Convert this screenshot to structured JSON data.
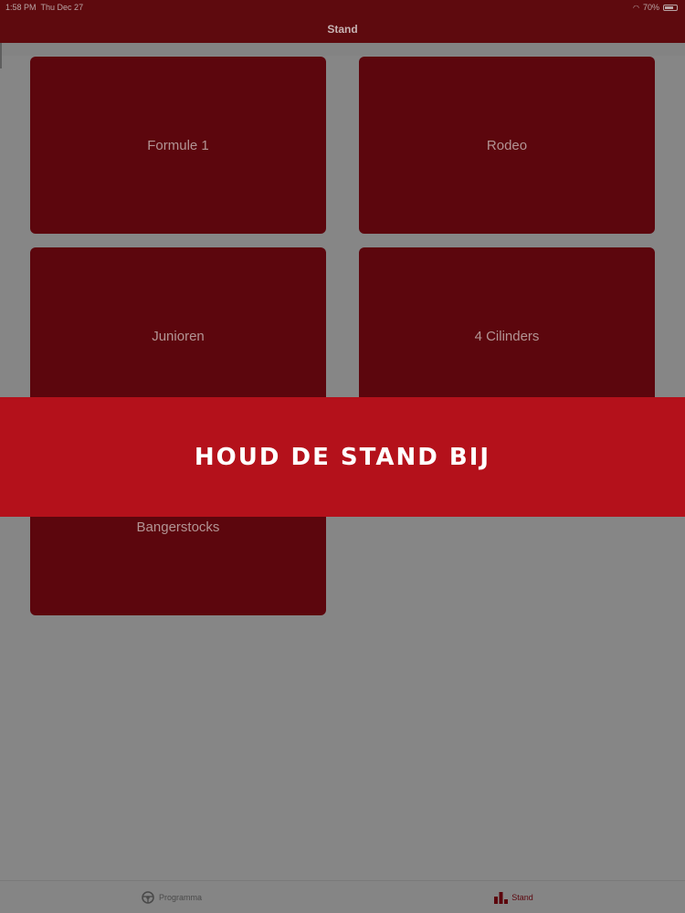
{
  "status_bar": {
    "time": "1:58 PM",
    "date": "Thu Dec 27",
    "battery": "70%"
  },
  "nav": {
    "title": "Stand"
  },
  "tiles": [
    {
      "label": "Formule 1"
    },
    {
      "label": "Rodeo"
    },
    {
      "label": "Junioren"
    },
    {
      "label": "4 Cilinders"
    },
    {
      "label": "Bangerstocks"
    }
  ],
  "banner": {
    "text": "HOUD DE STAND BIJ"
  },
  "tab_bar": {
    "items": [
      {
        "label": "Programma",
        "icon": "steering-wheel-icon",
        "active": false
      },
      {
        "label": "Stand",
        "icon": "podium-icon",
        "active": true
      }
    ]
  },
  "colors": {
    "primary": "#5c060d",
    "banner": "#b4111b",
    "background": "#868686"
  }
}
